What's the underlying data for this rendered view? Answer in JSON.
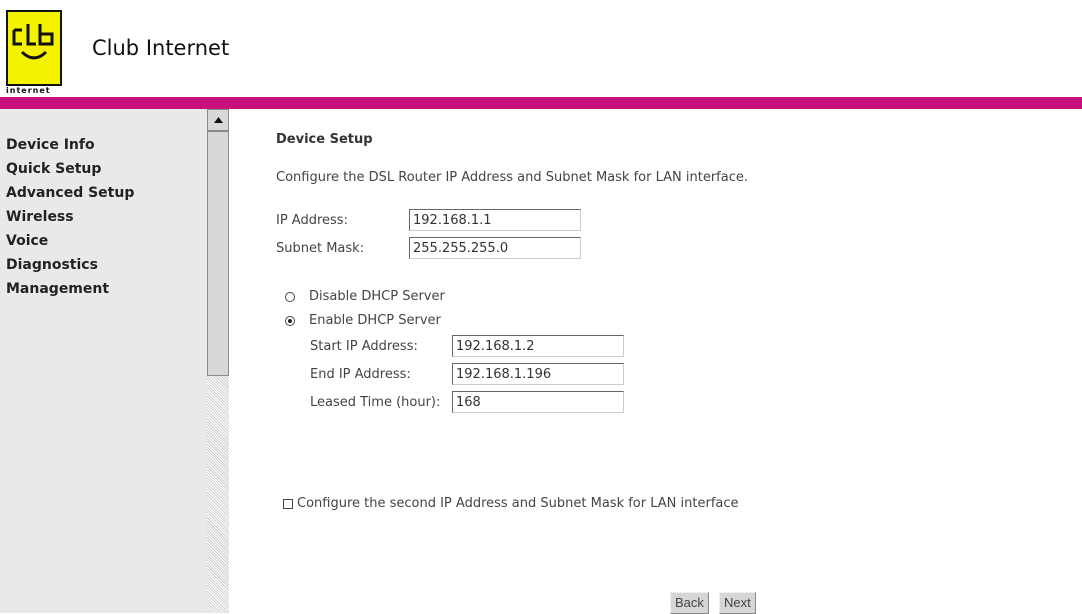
{
  "brand": {
    "name": "Club Internet",
    "logo_text": "CLUB",
    "logo_subtext": "internet",
    "bar_color": "#c8117a",
    "logo_color": "#f3f300"
  },
  "sidebar": {
    "items": [
      "Device Info",
      "Quick Setup",
      "Advanced Setup",
      "Wireless",
      "Voice",
      "Diagnostics",
      "Management"
    ]
  },
  "main": {
    "title": "Device Setup",
    "description": "Configure the DSL Router IP Address and Subnet Mask for LAN interface.",
    "ip_label": "IP Address:",
    "ip_value": "192.168.1.1",
    "mask_label": "Subnet Mask:",
    "mask_value": "255.255.255.0",
    "dhcp_disable_label": "Disable DHCP Server",
    "dhcp_enable_label": "Enable DHCP Server",
    "dhcp_selected": "enable",
    "start_label": "Start IP Address:",
    "start_value": "192.168.1.2",
    "end_label": "End IP Address:",
    "end_value": "192.168.1.196",
    "lease_label": "Leased Time (hour):",
    "lease_value": "168",
    "second_ip_label": "Configure the second IP Address and Subnet Mask for LAN interface",
    "second_ip_checked": false,
    "back_label": "Back",
    "next_label": "Next"
  }
}
